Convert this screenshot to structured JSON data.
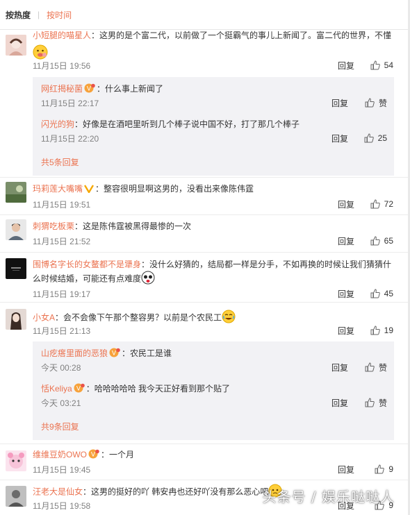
{
  "sort": {
    "hot": "按热度",
    "time": "按时间"
  },
  "comments": [
    {
      "user": "小短腿的喵星人",
      "text": "：这男的是个富二代，以前做了一个挺霸气的事儿上新闻了。富二代的世界，不懂",
      "time": "11月15日 19:56",
      "reply": "回复",
      "likes": "54"
    },
    {
      "user": "玛莉莲大嘴嘴",
      "text": "：整容很明显啊这男的，没看出来像陈伟霆",
      "time": "11月15日 19:51",
      "reply": "回复",
      "likes": "72"
    },
    {
      "user": "刺猬吃板栗",
      "text": "：这是陈伟霆被黑得最惨的一次",
      "time": "11月15日 21:52",
      "reply": "回复",
      "likes": "65"
    },
    {
      "user": "围博名字长的女鳌都不是犟身",
      "text": "：没什么好猜的，结局都一样是分手，不如再换的时候让我们猜猜什么时候结婚，可能还有点难度",
      "time": "11月15日 19:17",
      "reply": "回复",
      "likes": "45"
    },
    {
      "user": "小女A",
      "text": "：会不会像下午那个整容男？以前是个农民工",
      "time": "11月15日 21:13",
      "reply": "回复",
      "likes": "19"
    },
    {
      "user": "维维豆奶OWO",
      "text": "：一个月",
      "time": "11月15日 19:45",
      "reply": "回复",
      "likes": "9"
    },
    {
      "user": "汪老大是仙女",
      "text": "：这男的挺好的吖 韩安冉也还好吖没有那么恶心吧",
      "time": "11月15日 19:58",
      "reply": "回复",
      "likes": "9"
    }
  ],
  "subs1": [
    {
      "user": "网红揭秘菌",
      "text": "：什么事上新闻了",
      "time": "11月15日 22:17",
      "reply": "回复",
      "likes": "赞"
    },
    {
      "user": "闪光的狗",
      "text": "：好像是在酒吧里听到几个棒子说中国不好，打了那几个棒子",
      "time": "11月15日 22:20",
      "reply": "回复",
      "likes": "25"
    }
  ],
  "more1": "共5条回复",
  "subs2": [
    {
      "user": "山疙瘩里面的恶狼",
      "text": "：农民工是谁",
      "time": "今天 00:28",
      "reply": "回复",
      "likes": "赞"
    },
    {
      "user": "恬Keliya",
      "text": "：哈哈哈哈哈 我今天正好看到那个贴了",
      "time": "今天 03:21",
      "reply": "回复",
      "likes": "赞"
    }
  ],
  "more2": "共9条回复",
  "watermark": "头条号 / 娱乐哒哒人",
  "colors": {
    "link": "#eb7350",
    "subbg": "#f2f2f5",
    "text": "#333333",
    "meta": "#808080"
  }
}
